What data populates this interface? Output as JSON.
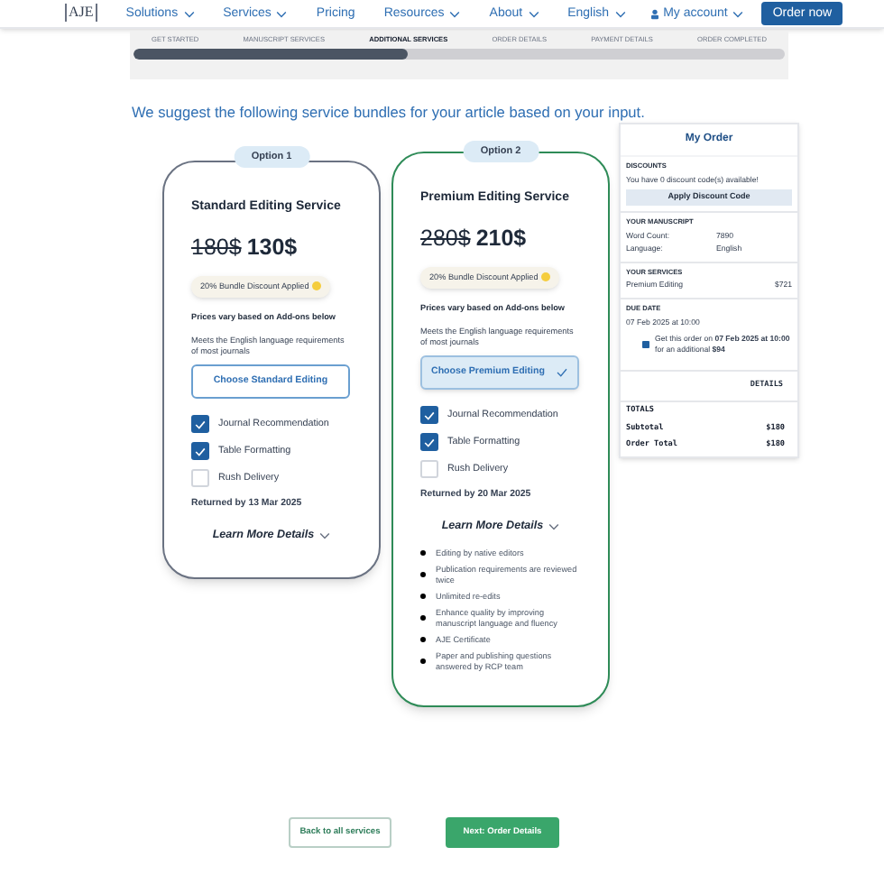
{
  "nav": {
    "logo": "AJE",
    "menu": [
      {
        "label": "Solutions",
        "dropdown": true
      },
      {
        "label": "Services",
        "dropdown": true
      },
      {
        "label": "Pricing",
        "dropdown": false
      },
      {
        "label": "Resources",
        "dropdown": true
      },
      {
        "label": "About",
        "dropdown": true
      }
    ],
    "language": "English",
    "account": "My account",
    "cta": "Order now"
  },
  "steps": [
    {
      "label": "GET STARTED",
      "selected": false
    },
    {
      "label": "MANUSCRIPT SERVICES",
      "selected": false
    },
    {
      "label": "ADDITIONAL SERVICES",
      "selected": true
    },
    {
      "label": "ORDER DETAILS",
      "selected": false
    },
    {
      "label": "PAYMENT DETAILS",
      "selected": false
    },
    {
      "label": "ORDER COMPLETED",
      "selected": false
    }
  ],
  "progress": {
    "level": 0.42
  },
  "headline": "We suggest the following service bundles for your article based on your input.",
  "options": [
    {
      "badge": "Option 1",
      "title": "Standard Editing Service",
      "old_price": "180$",
      "price": "130$",
      "discount": "20% Bundle Discount Applied",
      "note": "Prices vary based on Add-ons below",
      "description": "Meets the English language requirements of most journals",
      "choose": "Choose Standard Editing",
      "selected": false,
      "addons": [
        {
          "label": "Journal Recommendation",
          "checked": true
        },
        {
          "label": "Table Formatting",
          "checked": true
        },
        {
          "label": "Rush Delivery",
          "checked": false
        }
      ],
      "returned": "Returned by 13 Mar 2025",
      "learn_more": "Learn More Details"
    },
    {
      "badge": "Option 2",
      "title": "Premium Editing Service",
      "old_price": "280$",
      "price": "210$",
      "discount": "20% Bundle Discount Applied",
      "note": "Prices vary based on Add-ons below",
      "description": "Meets the English language requirements of most journals",
      "choose": "Choose Premium Editing",
      "selected": true,
      "addons": [
        {
          "label": "Journal Recommendation",
          "checked": true
        },
        {
          "label": "Table Formatting",
          "checked": true
        },
        {
          "label": "Rush Delivery",
          "checked": false
        }
      ],
      "returned": "Returned by 20 Mar 2025",
      "learn_more": "Learn More Details",
      "details": [
        "Editing by native editors",
        "Publication requirements are reviewed twice",
        "Unlimited re-edits",
        "Enhance quality by improving manuscript language and fluency",
        "AJE Certificate",
        "Paper and publishing questions answered by RCP team"
      ]
    }
  ],
  "order": {
    "title": "My Order",
    "discounts_heading": "DISCOUNTS",
    "discounts_text": "You have 0 discount code(s) available!",
    "apply": "Apply Discount Code",
    "manuscript_heading": "YOUR MANUSCRIPT",
    "manuscript": [
      {
        "label": "Word Count:",
        "value": "7890"
      },
      {
        "label": "Language:",
        "value": "English"
      }
    ],
    "services_heading": "YOUR SERVICES",
    "services": [
      {
        "label": "Premium Editing",
        "value": "$721"
      }
    ],
    "due_heading": "DUE DATE",
    "due": "07 Feb 2025 at 10:00",
    "rush_checked": true,
    "rush_text": "Get this order on **07 Feb 2025 at 10:00** for an additional **$94**",
    "details": "DETAILS",
    "totals_heading": "TOTALS",
    "totals": [
      {
        "label": "Subtotal",
        "value": "$180"
      },
      {
        "label": "Order Total",
        "value": "$180"
      }
    ]
  },
  "buttons": {
    "back": "Back to all services",
    "next": "Next: Order Details"
  }
}
